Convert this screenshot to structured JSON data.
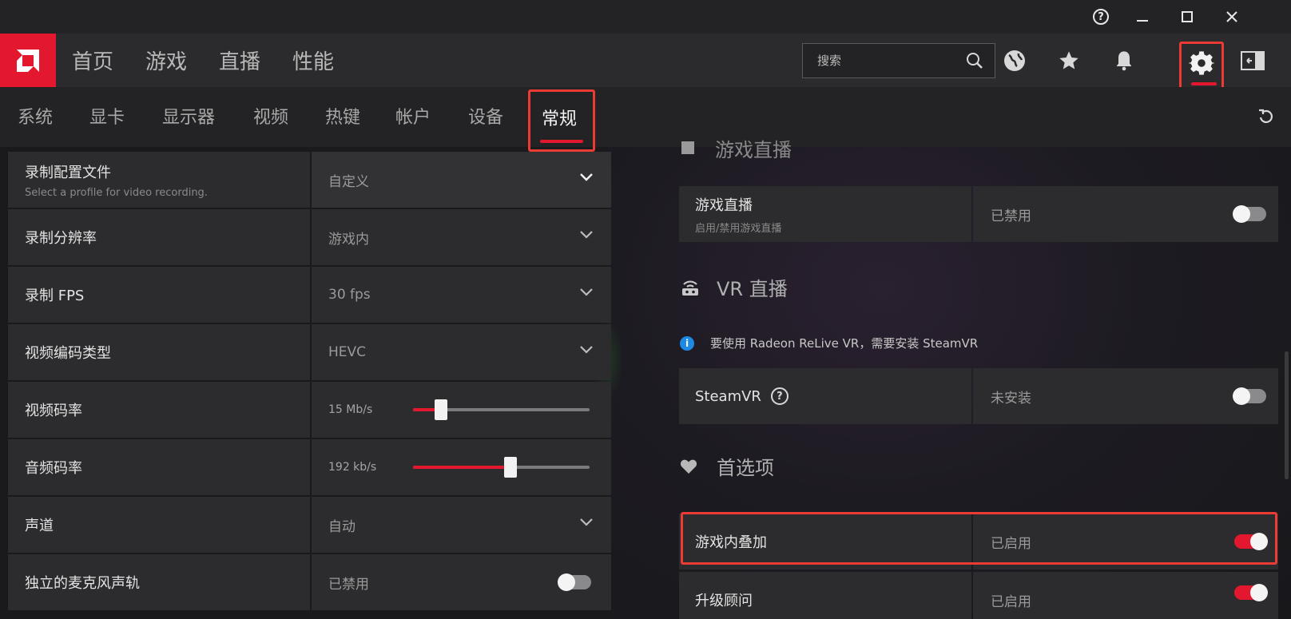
{
  "titlebar": {
    "help": "?",
    "minimize": "—",
    "maximize": "☐",
    "close": "✕"
  },
  "header": {
    "nav": [
      "首页",
      "游戏",
      "直播",
      "性能"
    ],
    "search_placeholder": "搜索"
  },
  "subnav": {
    "tabs": [
      "系统",
      "显卡",
      "显示器",
      "视频",
      "热键",
      "帐户",
      "设备",
      "常规"
    ],
    "active_tab": "常规"
  },
  "left_settings": [
    {
      "label": "录制配置文件",
      "sub": "Select a profile for video recording.",
      "value": "自定义",
      "control": "dropdown"
    },
    {
      "label": "录制分辨率",
      "value": "游戏内",
      "control": "dropdown"
    },
    {
      "label": "录制 FPS",
      "value": "30 fps",
      "control": "dropdown"
    },
    {
      "label": "视频编码类型",
      "value": "HEVC",
      "control": "dropdown"
    },
    {
      "label": "视频码率",
      "value": "15 Mb/s",
      "control": "slider",
      "level": 0.16
    },
    {
      "label": "音频码率",
      "value": "192 kb/s",
      "control": "slider",
      "level": 0.55
    },
    {
      "label": "声道",
      "value": "自动",
      "control": "dropdown"
    },
    {
      "label": "独立的麦克风声轨",
      "value": "已禁用",
      "control": "toggle",
      "on": false
    }
  ],
  "right": {
    "section_stream_partial": "游戏直播",
    "stream_row": {
      "label": "游戏直播",
      "sub": "启用/禁用游戏直播",
      "value": "已禁用",
      "on": false
    },
    "vr_section": "VR 直播",
    "vr_info": "要使用 Radeon ReLive VR，需要安装 SteamVR",
    "steamvr_row": {
      "label": "SteamVR",
      "help": "?",
      "value": "未安装",
      "on": false
    },
    "prefs_section": "首选项",
    "overlay_row": {
      "label": "游戏内叠加",
      "value": "已启用",
      "on": true
    },
    "advisor_row": {
      "label": "升级顾问",
      "value": "已启用",
      "on": true
    }
  },
  "colors": {
    "accent": "#e3172d",
    "highlight": "#ea3b35",
    "info": "#1e88e5"
  }
}
